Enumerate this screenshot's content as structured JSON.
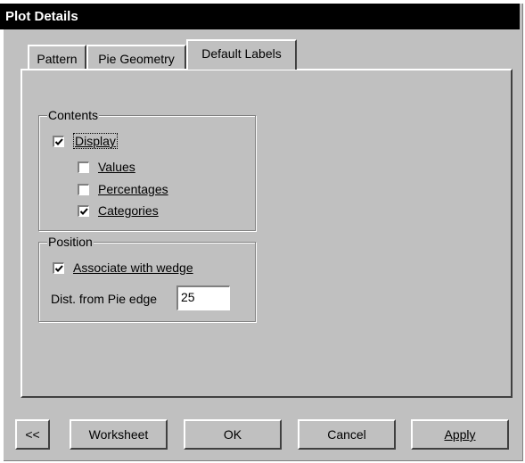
{
  "window": {
    "title": "Plot Details"
  },
  "tabs": [
    {
      "label": "Pattern",
      "active": false
    },
    {
      "label": "Pie Geometry",
      "active": false
    },
    {
      "label": "Default Labels",
      "active": true
    }
  ],
  "contents": {
    "legend": "Contents",
    "display": {
      "label": "Display",
      "checked": true
    },
    "values": {
      "label": "Values",
      "checked": false
    },
    "percentages": {
      "label": "Percentages",
      "checked": false
    },
    "categories": {
      "label": "Categories",
      "checked": true
    }
  },
  "position": {
    "legend": "Position",
    "associate": {
      "label": "Associate with wedge",
      "checked": true
    },
    "dist_label": "Dist. from Pie edge",
    "dist_value": "25"
  },
  "buttons": {
    "back": "<<",
    "worksheet": "Worksheet",
    "ok": "OK",
    "cancel": "Cancel",
    "apply": "Apply"
  }
}
